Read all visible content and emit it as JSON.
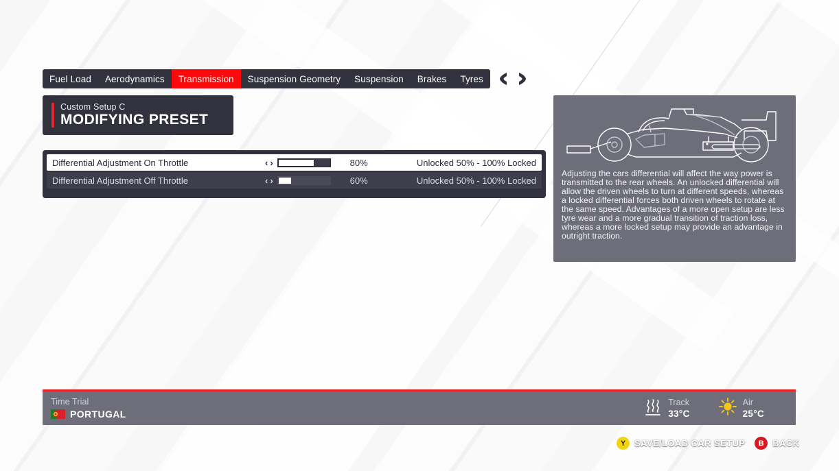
{
  "tabs": [
    {
      "label": "Fuel Load",
      "active": false
    },
    {
      "label": "Aerodynamics",
      "active": false
    },
    {
      "label": "Transmission",
      "active": true
    },
    {
      "label": "Suspension Geometry",
      "active": false
    },
    {
      "label": "Suspension",
      "active": false
    },
    {
      "label": "Brakes",
      "active": false
    },
    {
      "label": "Tyres",
      "active": false
    }
  ],
  "bumpers": {
    "left": "LB",
    "right": "RB"
  },
  "preset": {
    "subtitle": "Custom Setup  C",
    "title": "MODIFYING PRESET",
    "accent_color": "#e8252a"
  },
  "settings": [
    {
      "label": "Differential Adjustment On Throttle",
      "left_arrow": "‹",
      "right_arrow": "›",
      "value_text": "80%",
      "fill_percent": 70,
      "range_text": "Unlocked 50% - 100% Locked",
      "selected": true
    },
    {
      "label": "Differential Adjustment Off Throttle",
      "left_arrow": "‹",
      "right_arrow": "›",
      "value_text": "60%",
      "fill_percent": 27,
      "range_text": "Unlocked 50% - 100% Locked",
      "selected": false
    }
  ],
  "info": {
    "car_icon": "f1-car-side-view-icon",
    "description": "Adjusting the cars differential will affect the way power is transmitted to the rear wheels. An unlocked differential will allow the driven wheels to turn at different speeds, whereas a locked differential forces both driven wheels to rotate at the same speed. Advantages of a more open setup are less tyre wear and a more gradual transition of traction loss, whereas a more locked setup may provide an advantage in outright traction."
  },
  "status": {
    "mode": "Time Trial",
    "country": "PORTUGAL",
    "flag_icon": "portugal-flag-icon",
    "track": {
      "icon": "heat-waves-icon",
      "label": "Track",
      "value": "33°C"
    },
    "air": {
      "icon": "sun-icon",
      "label": "Air",
      "value": "25°C"
    }
  },
  "prompts": [
    {
      "button": "Y",
      "label": "SAVE/LOAD CAR SETUP",
      "color": "#f2d412"
    },
    {
      "button": "B",
      "label": "BACK",
      "color": "#d8191f"
    }
  ]
}
